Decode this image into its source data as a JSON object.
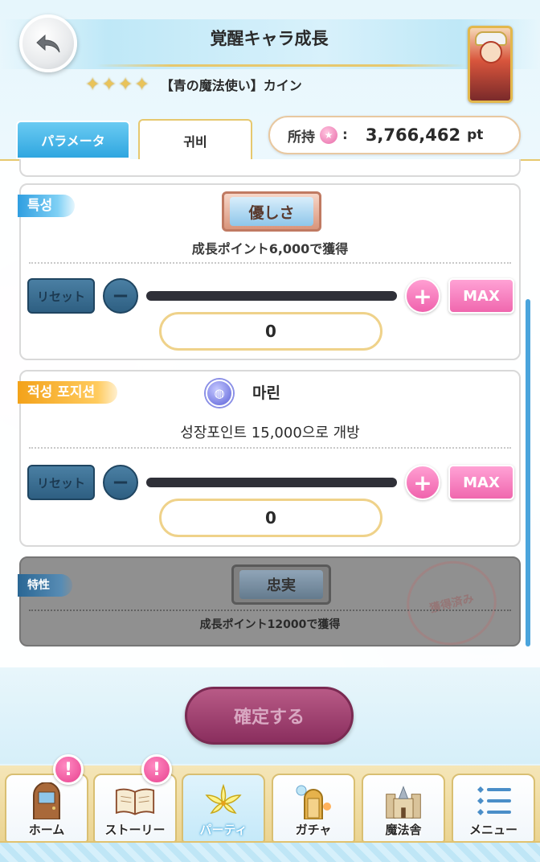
{
  "header": {
    "title": "覚醒キャラ成長",
    "stars": [
      "✦",
      "✦",
      "✦",
      "✦"
    ],
    "character_name": "【青の魔法使い】カイン"
  },
  "tabs": {
    "parameter": "パラメータ",
    "active": "귀비"
  },
  "points": {
    "label": "所持",
    "icon": "pink-star-coin",
    "colon": ":",
    "value": "3,766,462",
    "unit": "pt"
  },
  "sections": [
    {
      "ribbon": "특성",
      "trait": "優しさ",
      "unlock_text": "成長ポイント6,000で獲得",
      "reset_label": "リセット",
      "minus": "−",
      "plus": "+",
      "max_label": "MAX",
      "value": "0"
    },
    {
      "ribbon": "적성 포지션",
      "position_name": "마린",
      "unlock_text": "성장포인트 15,000으로 개방",
      "reset_label": "リセット",
      "minus": "−",
      "plus": "+",
      "max_label": "MAX",
      "value": "0"
    },
    {
      "ribbon": "特性",
      "trait": "忠実",
      "unlock_text": "成長ポイント12000で獲得",
      "stamp": "獲得済み"
    }
  ],
  "confirm_label": "確定する",
  "nav": [
    {
      "label": "ホーム",
      "icon": "door-icon",
      "alert": "!"
    },
    {
      "label": "ストーリー",
      "icon": "book-icon",
      "alert": "!"
    },
    {
      "label": "パーティ",
      "icon": "lily-icon"
    },
    {
      "label": "ガチャ",
      "icon": "gacha-door-icon"
    },
    {
      "label": "魔法舎",
      "icon": "castle-icon"
    },
    {
      "label": "メニュー",
      "icon": "menu-icon"
    }
  ],
  "colors": {
    "accent_blue": "#2fa6e0",
    "accent_pink": "#f062ad",
    "gold": "#e6c86e"
  }
}
